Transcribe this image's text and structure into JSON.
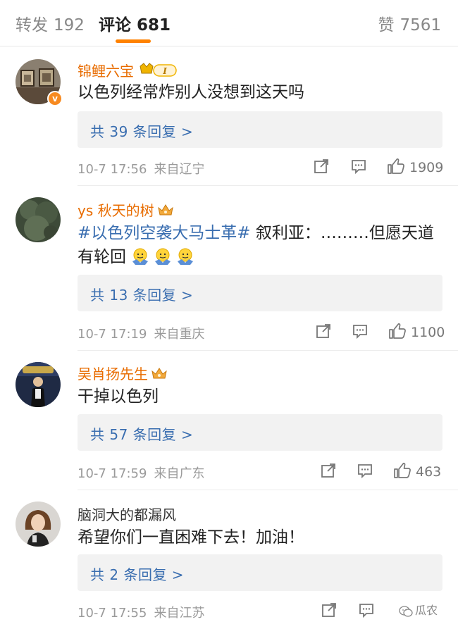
{
  "tabs": {
    "repost_label": "转发",
    "repost_count": "192",
    "comment_label": "评论",
    "comment_count": "681",
    "like_label": "赞",
    "like_count": "7561"
  },
  "colors": {
    "accent": "#ff8200",
    "username": "#e86c00",
    "link": "#3a6eb0",
    "muted": "#9a9a9a"
  },
  "comments": [
    {
      "username": "锦鲤六宝",
      "level_badge": "I",
      "verified_icon": "verified-v-icon",
      "text": "以色列经常炸别人没想到这天吗",
      "replies_label": "共 39 条回复 >",
      "time": "10-7 17:56",
      "location": "来自辽宁",
      "likes": "1909"
    },
    {
      "username": "ys 秋天的树",
      "badge_icon": "crown-icon",
      "topic": "#以色列空袭大马士革#",
      "text": " 叙利亚：………但愿天道有轮回",
      "emoji_icon": "shrug-emoji-icon",
      "replies_label": "共 13 条回复 >",
      "time": "10-7 17:19",
      "location": "来自重庆",
      "likes": "1100"
    },
    {
      "username": "吴肖扬先生",
      "badge_icon": "crown-icon",
      "text": "干掉以色列",
      "replies_label": "共 57 条回复 >",
      "time": "10-7 17:59",
      "location": "来自广东",
      "likes": "463"
    },
    {
      "username": "脑洞大的都漏风",
      "text": "希望你们一直困难下去！加油！",
      "replies_label": "共 2 条回复 >",
      "time": "10-7 17:55",
      "location": "来自江苏",
      "likes": ""
    }
  ],
  "watermark": "瓜农"
}
